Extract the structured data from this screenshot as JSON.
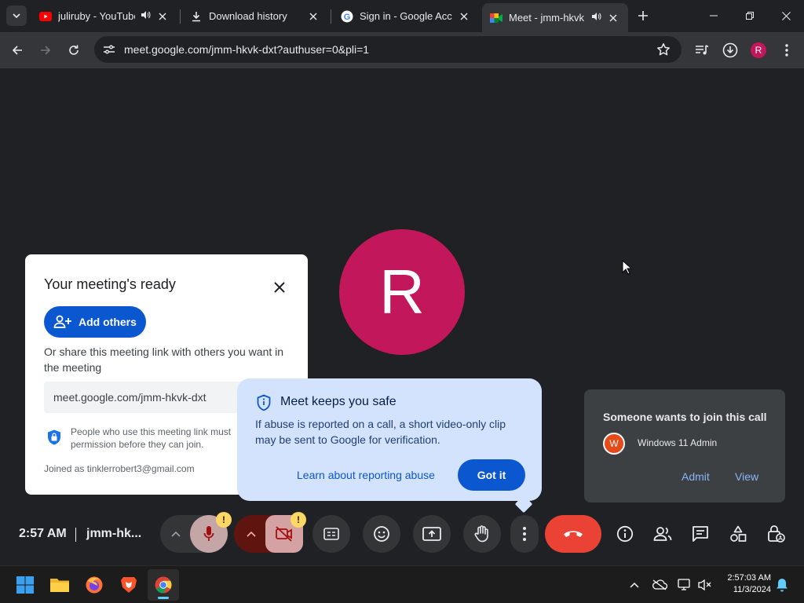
{
  "browser": {
    "tabs": [
      {
        "title": "juliruby - YouTube",
        "favicon": "youtube-icon",
        "audio": true
      },
      {
        "title": "Download history",
        "favicon": "download-icon",
        "audio": false
      },
      {
        "title": "Sign in - Google Accou",
        "favicon": "google-icon",
        "audio": false
      },
      {
        "title": "Meet - jmm-hkvk",
        "favicon": "meet-icon",
        "audio": true,
        "active": true
      }
    ],
    "url": "meet.google.com/jmm-hkvk-dxt?authuser=0&pli=1",
    "profile_initial": "R"
  },
  "meet": {
    "avatar_initial": "R",
    "avatar_color": "#c2185b",
    "ready_card": {
      "title": "Your meeting's ready",
      "add_others": "Add others",
      "share_text": "Or share this meeting link with others you want in the meeting",
      "link": "meet.google.com/jmm-hkvk-dxt",
      "permission_text_1": "People who use this meeting link must",
      "permission_text_2": "permission before they can join.",
      "joined_as": "Joined as tinklerrobert3@gmail.com"
    },
    "safe_bubble": {
      "title": "Meet keeps you safe",
      "body": "If abuse is reported on a call, a short video-only clip may be sent to Google for verification.",
      "learn_link": "Learn about reporting abuse",
      "got_it": "Got it"
    },
    "join_request": {
      "title": "Someone wants to join this call",
      "name": "Windows 11 Admin",
      "initial": "W",
      "admit": "Admit",
      "view": "View"
    },
    "controls": {
      "time": "2:57 AM",
      "code": "jmm-hk...",
      "warn_mark": "!"
    }
  },
  "taskbar": {
    "time": "2:57:03 AM",
    "date": "11/3/2024"
  },
  "colors": {
    "accent": "#0b57d0",
    "end_call": "#ea4335",
    "mic_off": "#c4a6a6",
    "cam_off": "#d4a2a2"
  }
}
